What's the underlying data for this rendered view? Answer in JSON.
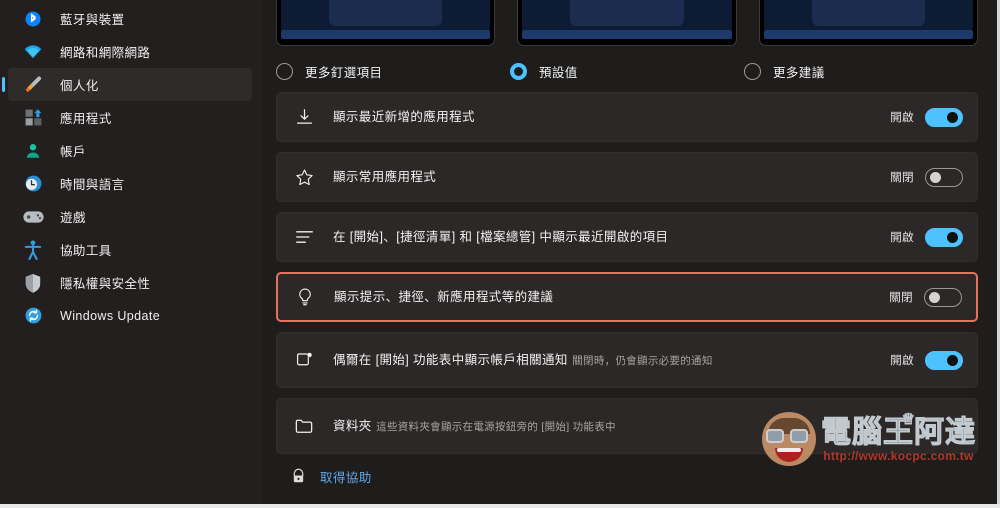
{
  "sidebar": {
    "items": [
      {
        "label": "藍牙與裝置",
        "icon": "bluetooth-icon",
        "selected": false
      },
      {
        "label": "網路和網際網路",
        "icon": "wifi-icon",
        "selected": false
      },
      {
        "label": "個人化",
        "icon": "paintbrush-icon",
        "selected": true
      },
      {
        "label": "應用程式",
        "icon": "apps-icon",
        "selected": false
      },
      {
        "label": "帳戶",
        "icon": "account-icon",
        "selected": false
      },
      {
        "label": "時間與語言",
        "icon": "clock-globe-icon",
        "selected": false
      },
      {
        "label": "遊戲",
        "icon": "gamepad-icon",
        "selected": false
      },
      {
        "label": "協助工具",
        "icon": "accessibility-icon",
        "selected": false
      },
      {
        "label": "隱私權與安全性",
        "icon": "shield-icon",
        "selected": false
      },
      {
        "label": "Windows Update",
        "icon": "update-icon",
        "selected": false
      }
    ]
  },
  "layout_options": {
    "options": [
      {
        "label": "更多釘選項目",
        "checked": false
      },
      {
        "label": "預設值",
        "checked": true
      },
      {
        "label": "更多建議",
        "checked": false
      }
    ]
  },
  "settings": {
    "rows": [
      {
        "icon": "download-icon",
        "title": "顯示最近新增的應用程式",
        "subtitle": "",
        "state_label": "開啟",
        "on": true,
        "highlighted": false,
        "control": "toggle"
      },
      {
        "icon": "star-icon",
        "title": "顯示常用應用程式",
        "subtitle": "",
        "state_label": "關閉",
        "on": false,
        "highlighted": false,
        "control": "toggle"
      },
      {
        "icon": "list-icon",
        "title": "在 [開始]、[捷徑清單] 和 [檔案總管] 中顯示最近開啟的項目",
        "subtitle": "",
        "state_label": "開啟",
        "on": true,
        "highlighted": false,
        "control": "toggle"
      },
      {
        "icon": "lightbulb-icon",
        "title": "顯示提示、捷徑、新應用程式等的建議",
        "subtitle": "",
        "state_label": "關閉",
        "on": false,
        "highlighted": true,
        "control": "toggle"
      },
      {
        "icon": "notification-badge-icon",
        "title": "偶爾在 [開始] 功能表中顯示帳戶相關通知",
        "subtitle": "關閉時，仍會顯示必要的通知",
        "state_label": "開啟",
        "on": true,
        "highlighted": false,
        "control": "toggle"
      },
      {
        "icon": "folder-icon",
        "title": "資料夾",
        "subtitle": "這些資料夾會顯示在電源按鈕旁的 [開始] 功能表中",
        "state_label": "",
        "on": false,
        "highlighted": false,
        "control": "chevron",
        "chevron": "›"
      }
    ]
  },
  "help": {
    "label": "取得協助",
    "icon": "help-lock-icon"
  },
  "watermark": {
    "title": "電腦王阿達",
    "url": "http://www.kocpc.com.tw",
    "crown": "♛"
  },
  "colors": {
    "accent": "#4cc2ff",
    "highlight_border": "#e8705f",
    "card_bg": "#2b2827",
    "page_bg": "#1f1d1c",
    "sidebar_bg": "#221f1e",
    "link": "#63a6e8"
  }
}
